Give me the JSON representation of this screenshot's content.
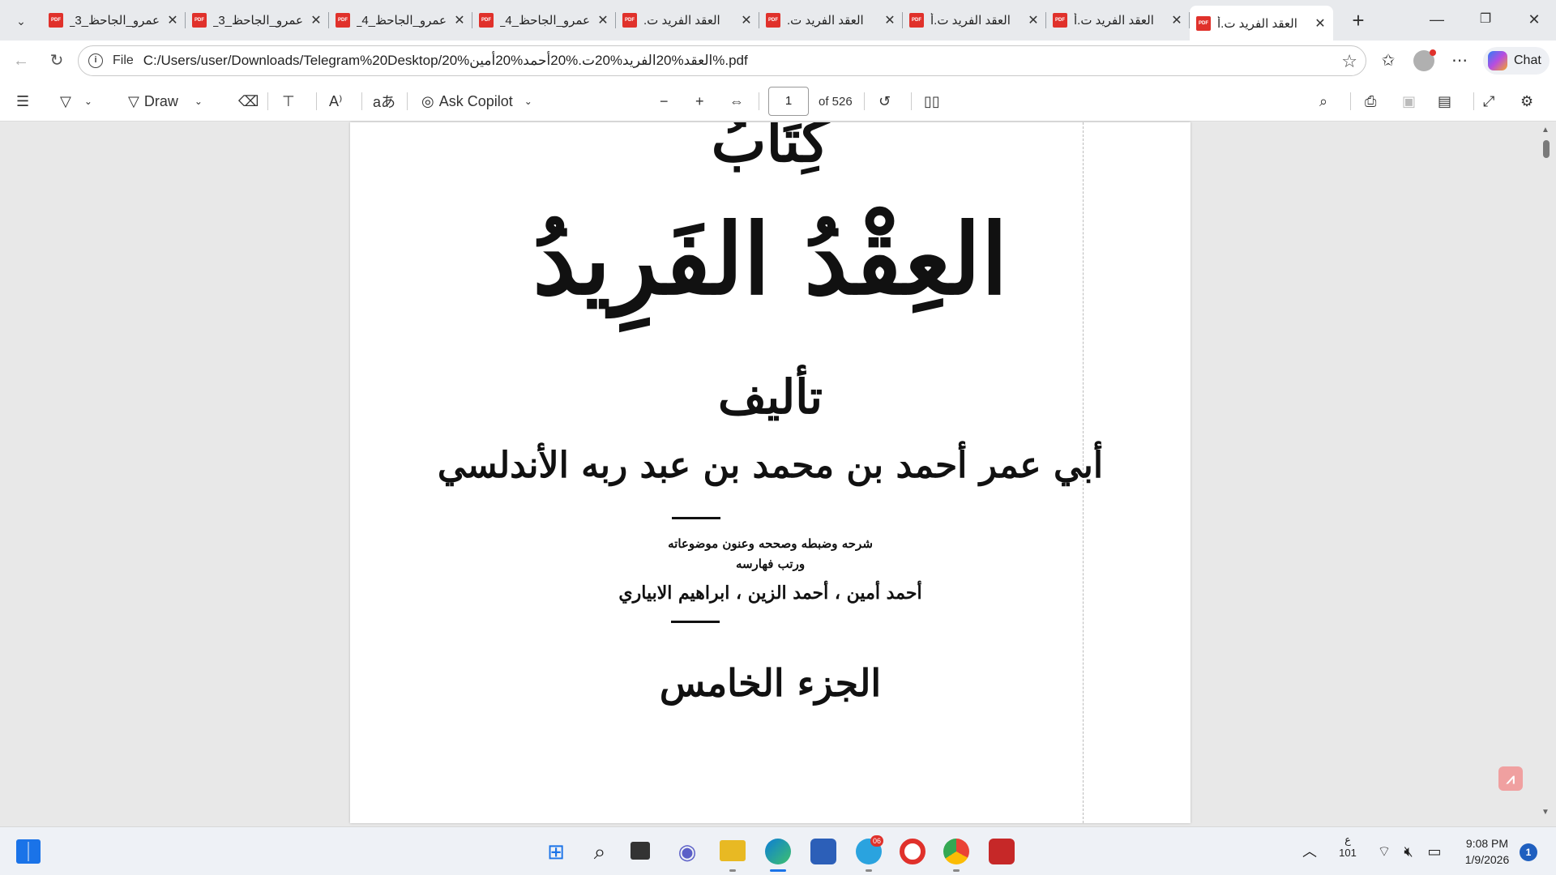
{
  "tabs": [
    {
      "title": "عمرو_الجاحظ_3_ا",
      "close": "✕"
    },
    {
      "title": "عمرو_الجاحظ_3_ا",
      "close": "✕"
    },
    {
      "title": "عمرو_الجاحظ_4_ا",
      "close": "✕"
    },
    {
      "title": "عمرو_الجاحظ_4_ا",
      "close": "✕"
    },
    {
      "title": "العقد الفريد ت.",
      "close": "✕"
    },
    {
      "title": "العقد الفريد ت.",
      "close": "✕"
    },
    {
      "title": "العقد الفريد ت.أ",
      "close": "✕"
    },
    {
      "title": "العقد الفريد ت.أ",
      "close": "✕"
    },
    {
      "title": "العقد الفريد ت.أ",
      "close": "✕"
    }
  ],
  "pdf_badge": "PDF",
  "address": {
    "scheme": "File",
    "url": "C:/Users/user/Downloads/Telegram%20Desktop/20%العقد%20الفريد%20ت.%20أحمد%20أمين%.pdf"
  },
  "chat_label": "Chat",
  "pdf_toolbar": {
    "draw_label": "Draw",
    "copilot_label": "Ask Copilot",
    "current_page": "1",
    "page_total": "of 526"
  },
  "document": {
    "kitab": "كِتَابُ",
    "title": "العِقْدُ الفَرِيدُ",
    "talif": "تأليف",
    "author": "أبي عمر أحمد بن محمد بن عبد ربه الأندلسي",
    "credits_line1": "شرحه وضبطه وصححه وعنون موضوعاته",
    "credits_line2": "ورتب فهارسه",
    "editors": "أحمد أمين ، أحمد الزين ، ابراهيم الابياري",
    "volume": "الجزء الخامس"
  },
  "tray": {
    "lang_top": "ع",
    "lang_bottom": "101",
    "time": "9:08 PM",
    "date": "1/9/2026",
    "notifications": "1",
    "telegram_badge": "06"
  }
}
